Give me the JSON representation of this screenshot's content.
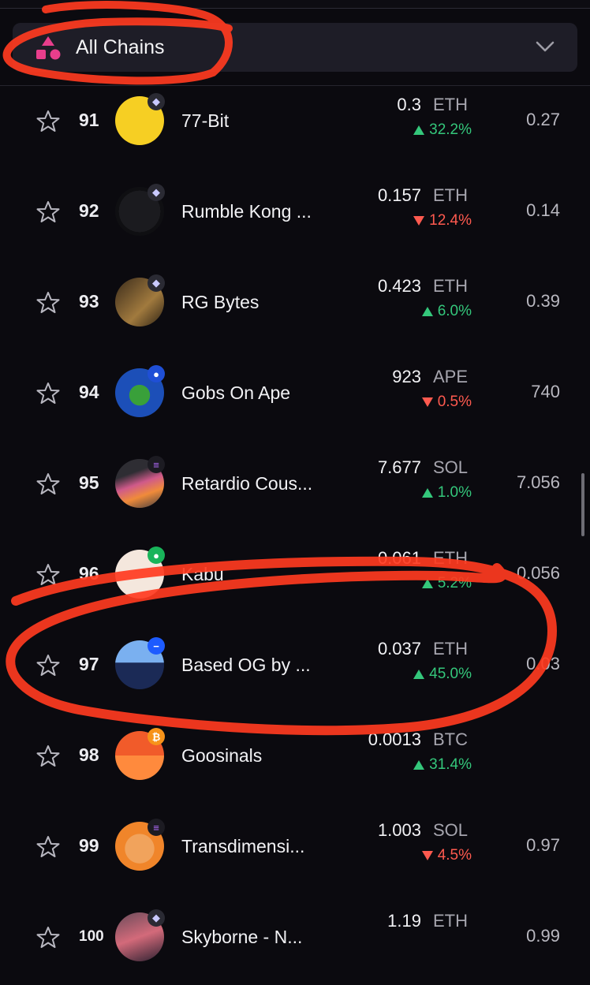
{
  "filter": {
    "selected_chain": "All Chains"
  },
  "rows": [
    {
      "rank": "91",
      "name": "77-Bit",
      "price": "0.3",
      "currency": "ETH",
      "change": "32.2%",
      "direction": "up",
      "floor": "0.27",
      "chain": "eth"
    },
    {
      "rank": "92",
      "name": "Rumble Kong ...",
      "price": "0.157",
      "currency": "ETH",
      "change": "12.4%",
      "direction": "down",
      "floor": "0.14",
      "chain": "eth"
    },
    {
      "rank": "93",
      "name": "RG Bytes",
      "price": "0.423",
      "currency": "ETH",
      "change": "6.0%",
      "direction": "up",
      "floor": "0.39",
      "chain": "eth"
    },
    {
      "rank": "94",
      "name": "Gobs On Ape",
      "price": "923",
      "currency": "APE",
      "change": "0.5%",
      "direction": "down",
      "floor": "740",
      "chain": "ape"
    },
    {
      "rank": "95",
      "name": "Retardio Cous...",
      "price": "7.677",
      "currency": "SOL",
      "change": "1.0%",
      "direction": "up",
      "floor": "7.056",
      "chain": "sol"
    },
    {
      "rank": "96",
      "name": "Kabu",
      "price": "0.061",
      "currency": "ETH",
      "change": "5.2%",
      "direction": "up",
      "floor": "0.056",
      "chain": "green"
    },
    {
      "rank": "97",
      "name": "Based OG by ...",
      "price": "0.037",
      "currency": "ETH",
      "change": "45.0%",
      "direction": "up",
      "floor": "0.03",
      "chain": "base"
    },
    {
      "rank": "98",
      "name": "Goosinals",
      "price": "0.0013",
      "currency": "BTC",
      "change": "31.4%",
      "direction": "up",
      "floor": "",
      "chain": "btc"
    },
    {
      "rank": "99",
      "name": "Transdimensi...",
      "price": "1.003",
      "currency": "SOL",
      "change": "4.5%",
      "direction": "down",
      "floor": "0.97",
      "chain": "sol"
    },
    {
      "rank": "100",
      "name": "Skyborne - N...",
      "price": "1.19",
      "currency": "ETH",
      "change": "",
      "direction": "down",
      "floor": "0.99",
      "chain": "eth"
    }
  ],
  "colors": {
    "background": "#0b0a0f",
    "up": "#34c77b",
    "down": "#ff5a4f",
    "annotation": "#ff3b1f"
  }
}
